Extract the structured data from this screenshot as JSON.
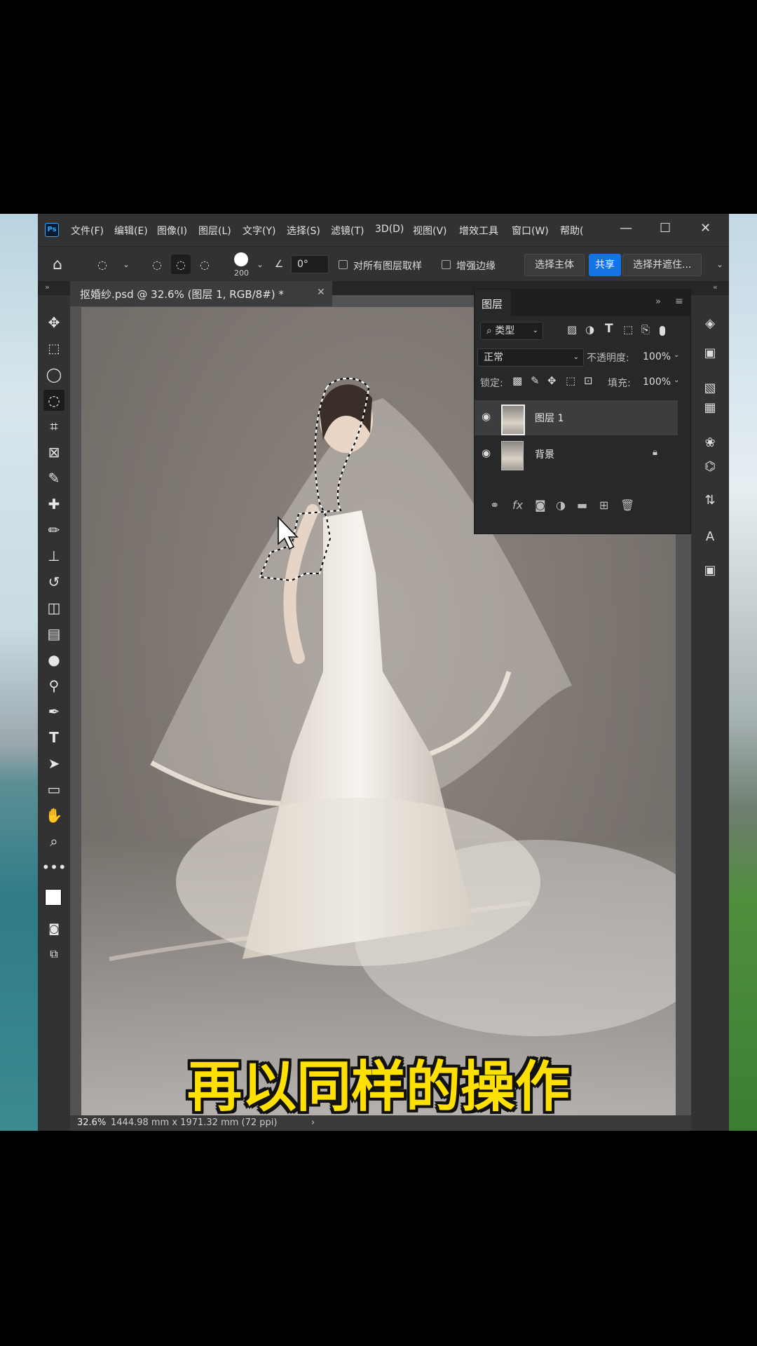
{
  "titlebar": {
    "logo": "Ps",
    "menus": [
      "文件(F)",
      "编辑(E)",
      "图像(I)",
      "图层(L)",
      "文字(Y)",
      "选择(S)",
      "滤镜(T)",
      "3D(D)",
      "视图(V)",
      "增效工具",
      "窗口(W)",
      "帮助("
    ],
    "window_controls": {
      "minimize": "—",
      "maximize": "☐",
      "close": "✕"
    }
  },
  "options": {
    "brush_size": "200",
    "angle_value": "0°",
    "sample_all_layers": "对所有图层取样",
    "enhance_edge": "增强边缘",
    "select_subject": "选择主体",
    "share": "共享",
    "select_and_mask": "选择并遮住..."
  },
  "document": {
    "tab_title": "抠婚纱.psd @ 32.6% (图层 1, RGB/8#) *",
    "zoom": "32.6%",
    "dimensions": "1444.98 mm x 1971.32 mm (72 ppi)"
  },
  "layers_panel": {
    "tab_label": "图层",
    "filter_kind": "类型",
    "blend_mode": "正常",
    "opacity_label": "不透明度:",
    "opacity_value": "100%",
    "lock_label": "锁定:",
    "fill_label": "填充:",
    "fill_value": "100%",
    "layers": [
      {
        "name": "图层 1",
        "selected": true,
        "visible": true,
        "locked": false
      },
      {
        "name": "背景",
        "selected": false,
        "visible": true,
        "locked": true
      }
    ]
  },
  "caption": "再以同样的操作",
  "colors": {
    "accent": "#1473e6",
    "caption": "#ffe000",
    "panel_bg": "#282828",
    "chrome_bg": "#323232"
  }
}
